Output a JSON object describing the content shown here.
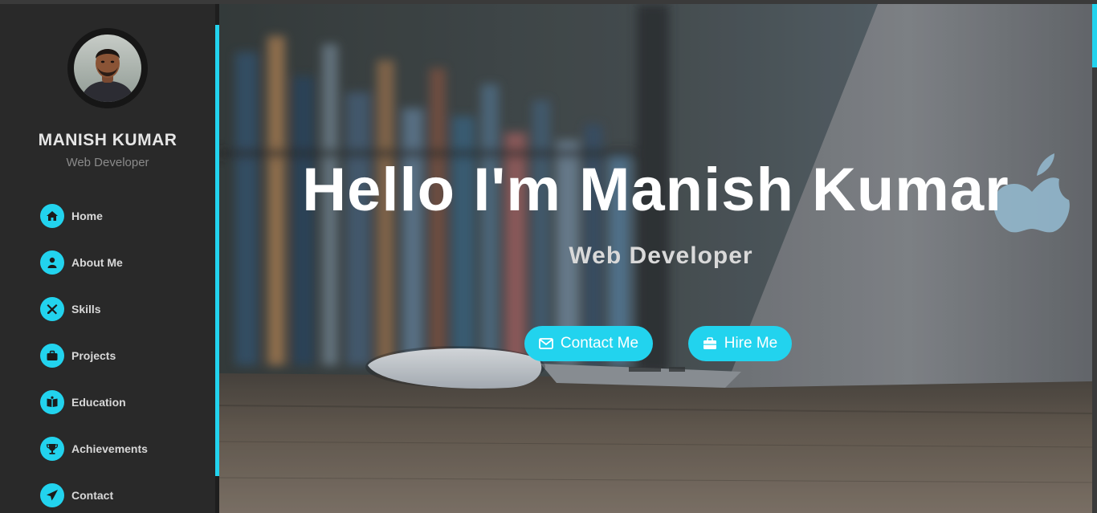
{
  "profile": {
    "name": "MANISH KUMAR",
    "role": "Web Developer",
    "avatar": "profile-photo"
  },
  "nav": {
    "items": [
      {
        "label": "Home",
        "icon": "home-icon"
      },
      {
        "label": "About Me",
        "icon": "user-icon"
      },
      {
        "label": "Skills",
        "icon": "tools-icon"
      },
      {
        "label": "Projects",
        "icon": "briefcase-icon"
      },
      {
        "label": "Education",
        "icon": "book-icon"
      },
      {
        "label": "Achievements",
        "icon": "trophy-icon"
      },
      {
        "label": "Contact",
        "icon": "paper-plane-icon"
      }
    ]
  },
  "hero": {
    "headline": "Hello I'm Manish Kumar",
    "subline": "Web Developer",
    "contact_label": "Contact Me",
    "hire_label": "Hire Me"
  },
  "colors": {
    "accent": "#22d3ee",
    "sidebar": "#292929",
    "text": "#ffffff"
  }
}
